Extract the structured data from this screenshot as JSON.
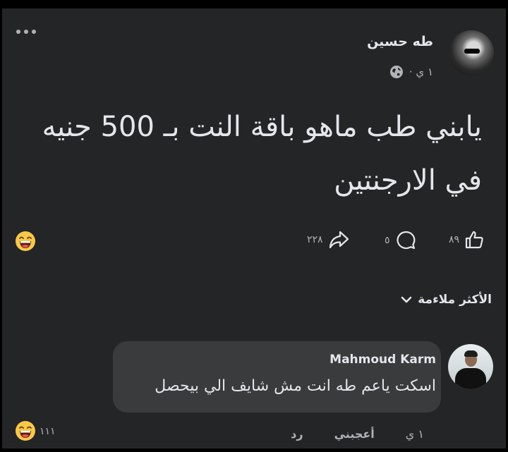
{
  "post": {
    "author": "طه حسين",
    "time": "١ ي ·",
    "text_line1": "يابني طب ماهو باقة النت بـ 500 جنيه",
    "text_line2": "في الارجنتين",
    "likes": "٨٩",
    "comments": "٥",
    "shares": "٢٢٨",
    "reaction_icon": "laughing-emoji"
  },
  "sort": {
    "label": "الأكثر ملاءمة"
  },
  "comment": {
    "author": "Mahmoud Karm",
    "text": "اسكت ياعم طه انت مش شايف الي بيحصل",
    "time": "١ ي",
    "like_label": "أعجبني",
    "reply_label": "رد",
    "reactions_count": "١١١",
    "reaction_icon": "laughing-emoji"
  },
  "colors": {
    "background": "#242526",
    "comment_bubble": "#3a3b3c",
    "text_primary": "#e4e6eb",
    "text_secondary": "#b0b3b8"
  }
}
